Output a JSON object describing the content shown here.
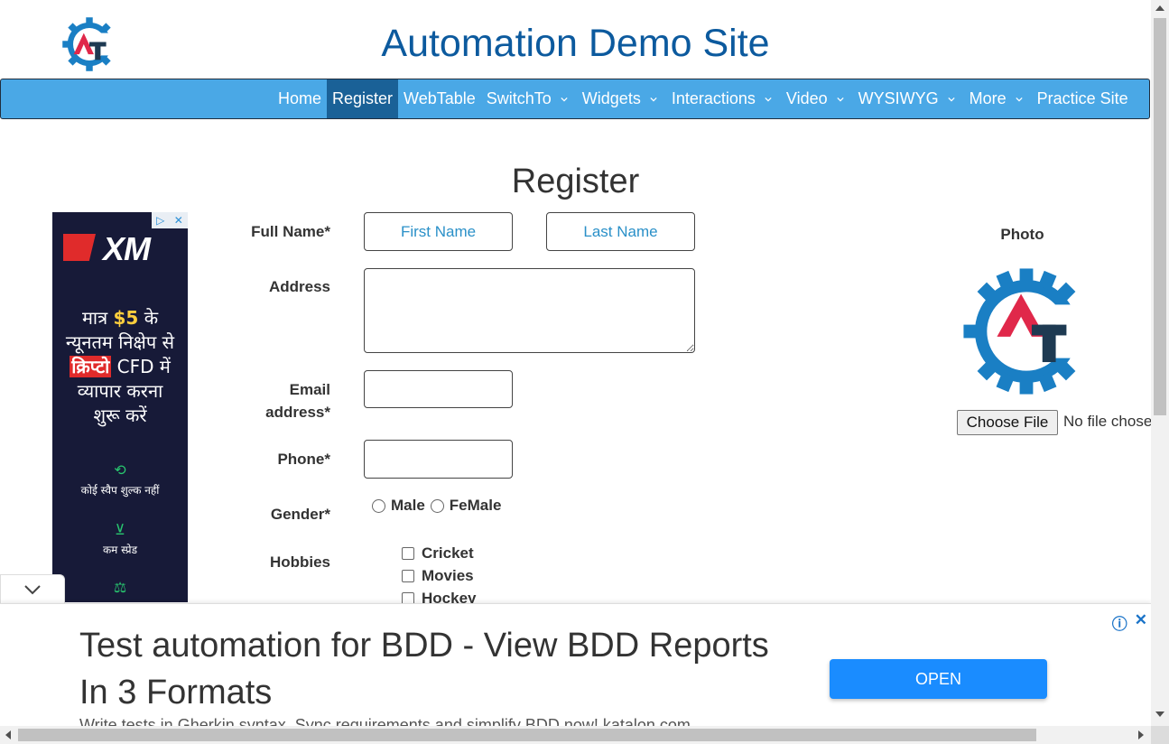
{
  "site": {
    "title": "Automation Demo Site"
  },
  "nav": {
    "items": [
      {
        "label": "Home",
        "dropdown": false
      },
      {
        "label": "Register",
        "dropdown": false,
        "active": true
      },
      {
        "label": "WebTable",
        "dropdown": false
      },
      {
        "label": "SwitchTo",
        "dropdown": true
      },
      {
        "label": "Widgets",
        "dropdown": true
      },
      {
        "label": "Interactions",
        "dropdown": true
      },
      {
        "label": "Video",
        "dropdown": true
      },
      {
        "label": "WYSIWYG",
        "dropdown": true
      },
      {
        "label": "More",
        "dropdown": true
      },
      {
        "label": "Practice Site",
        "dropdown": false
      }
    ]
  },
  "page": {
    "heading": "Register"
  },
  "form": {
    "full_name_label": "Full Name*",
    "first_name_placeholder": "First Name",
    "last_name_placeholder": "Last Name",
    "address_label": "Address",
    "email_label_line1": "Email",
    "email_label_line2": "address*",
    "phone_label": "Phone*",
    "gender_label": "Gender*",
    "gender_options": [
      "Male",
      "FeMale"
    ],
    "hobbies_label": "Hobbies",
    "hobbies": [
      "Cricket",
      "Movies",
      "Hockey"
    ],
    "photo_label": "Photo",
    "choose_file_label": "Choose File",
    "file_status": "No file chosen"
  },
  "side_ad": {
    "brand": "XM",
    "hindi_line1": "मात्र",
    "money": "$5",
    "hindi_line1_end": "के",
    "hindi_line2": "न्यूनतम निक्षेप से",
    "crypto": "क्रिप्टो",
    "hindi_line3_end": "CFD में",
    "hindi_line4": "व्यापार करना",
    "hindi_line5": "शुरू करें",
    "feature1": "कोई स्वैप शुल्क नहीं",
    "feature2": "कम स्प्रेड"
  },
  "bottom_ad": {
    "headline": "Test automation for BDD - View BDD Reports In 3 Formats",
    "subtext": "Write tests in Gherkin syntax. Sync requirements and simplify BDD now! katalon.com",
    "open_label": "OPEN"
  },
  "colors": {
    "navbar": "#4aa8e6",
    "nav_active": "#1a6197",
    "title": "#0c5a9e",
    "open_button": "#1a8cff",
    "logo_blue": "#1a7fc4",
    "logo_red": "#e0284a",
    "logo_navy": "#1e3a52"
  }
}
